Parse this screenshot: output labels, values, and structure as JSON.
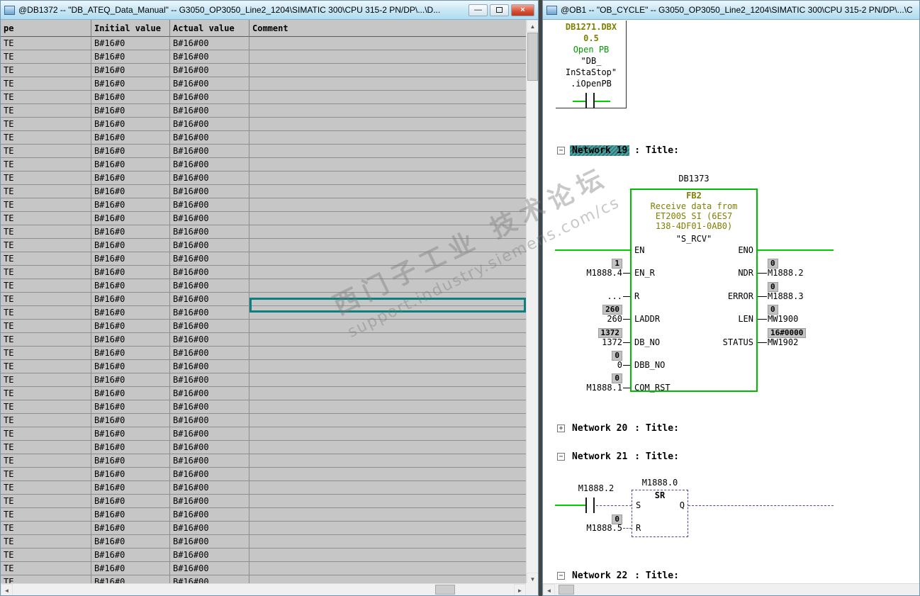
{
  "watermark": {
    "line1": "西门子工业 技术论坛",
    "line2": "support.industry.siemens.com/cs"
  },
  "icons": {
    "minimize": "—",
    "close": "×",
    "scroll_up": "▲",
    "scroll_down": "▼",
    "scroll_left": "◄",
    "scroll_right": "►",
    "collapse": "−",
    "expand": "+"
  },
  "left_window": {
    "title": "@DB1372 -- \"DB_ATEQ_Data_Manual\" -- G3050_OP3050_Line2_1204\\SIMATIC 300\\CPU 315-2 PN/DP\\...\\D...",
    "table": {
      "headers": [
        "pe",
        "Initial value",
        "Actual value",
        "Comment"
      ],
      "row": {
        "type": "TE",
        "initial": "B#16#0",
        "actual": "B#16#00",
        "comment": ""
      },
      "row_count": 41,
      "selected_row": 18
    }
  },
  "right_window": {
    "title": "@OB1 -- \"OB_CYCLE\" -- G3050_OP3050_Line2_1204\\SIMATIC 300\\CPU 315-2 PN/DP\\...\\C",
    "top_element": {
      "address_line1": "DB1271.DBX",
      "address_line2": "0.5",
      "comment": "Open PB",
      "symbol_line1": "\"DB_",
      "symbol_line2": "InStaStop\"",
      "symbol_line3": ".iOpenPB"
    },
    "networks": [
      {
        "label": "Network 19",
        "suffix": ": Title:",
        "collapsed": false,
        "selected": true
      },
      {
        "label": "Network 20",
        "suffix": ": Title:",
        "collapsed": true,
        "selected": false
      },
      {
        "label": "Network 21",
        "suffix": ": Title:",
        "collapsed": false,
        "selected": false
      },
      {
        "label": "Network 22",
        "suffix": ": Title:",
        "collapsed": false,
        "selected": false
      }
    ],
    "fb_block": {
      "db_label": "DB1373",
      "fb_name": "FB2",
      "comment_lines": [
        "Receive data from",
        "ET200S SI (6ES7",
        "138-4DF01-0AB0)"
      ],
      "symbol": "\"S_RCV\"",
      "inputs": [
        {
          "pin": "EN",
          "operand": "",
          "value": ""
        },
        {
          "pin": "EN_R",
          "operand": "M1888.4",
          "value": "1"
        },
        {
          "pin": "R",
          "operand": "...",
          "value": ""
        },
        {
          "pin": "LADDR",
          "operand": "260",
          "value": "260"
        },
        {
          "pin": "DB_NO",
          "operand": "1372",
          "value": "1372"
        },
        {
          "pin": "DBB_NO",
          "operand": "0",
          "value": "0"
        },
        {
          "pin": "COM_RST",
          "operand": "M1888.1",
          "value": "0"
        }
      ],
      "outputs": [
        {
          "pin": "ENO",
          "operand": "",
          "value": ""
        },
        {
          "pin": "NDR",
          "operand": "M1888.2",
          "value": "0"
        },
        {
          "pin": "ERROR",
          "operand": "M1888.3",
          "value": "0"
        },
        {
          "pin": "LEN",
          "operand": "MW1900",
          "value": "0"
        },
        {
          "pin": "STATUS",
          "operand": "MW1902",
          "value": "16#0000"
        }
      ]
    },
    "sr_network": {
      "contact_operand": "M1888.2",
      "block_operand": "M1888.0",
      "block_label": "SR",
      "s_label": "S",
      "q_label": "Q",
      "r_label": "R",
      "r_operand": "M1888.5",
      "r_value": "0"
    }
  }
}
